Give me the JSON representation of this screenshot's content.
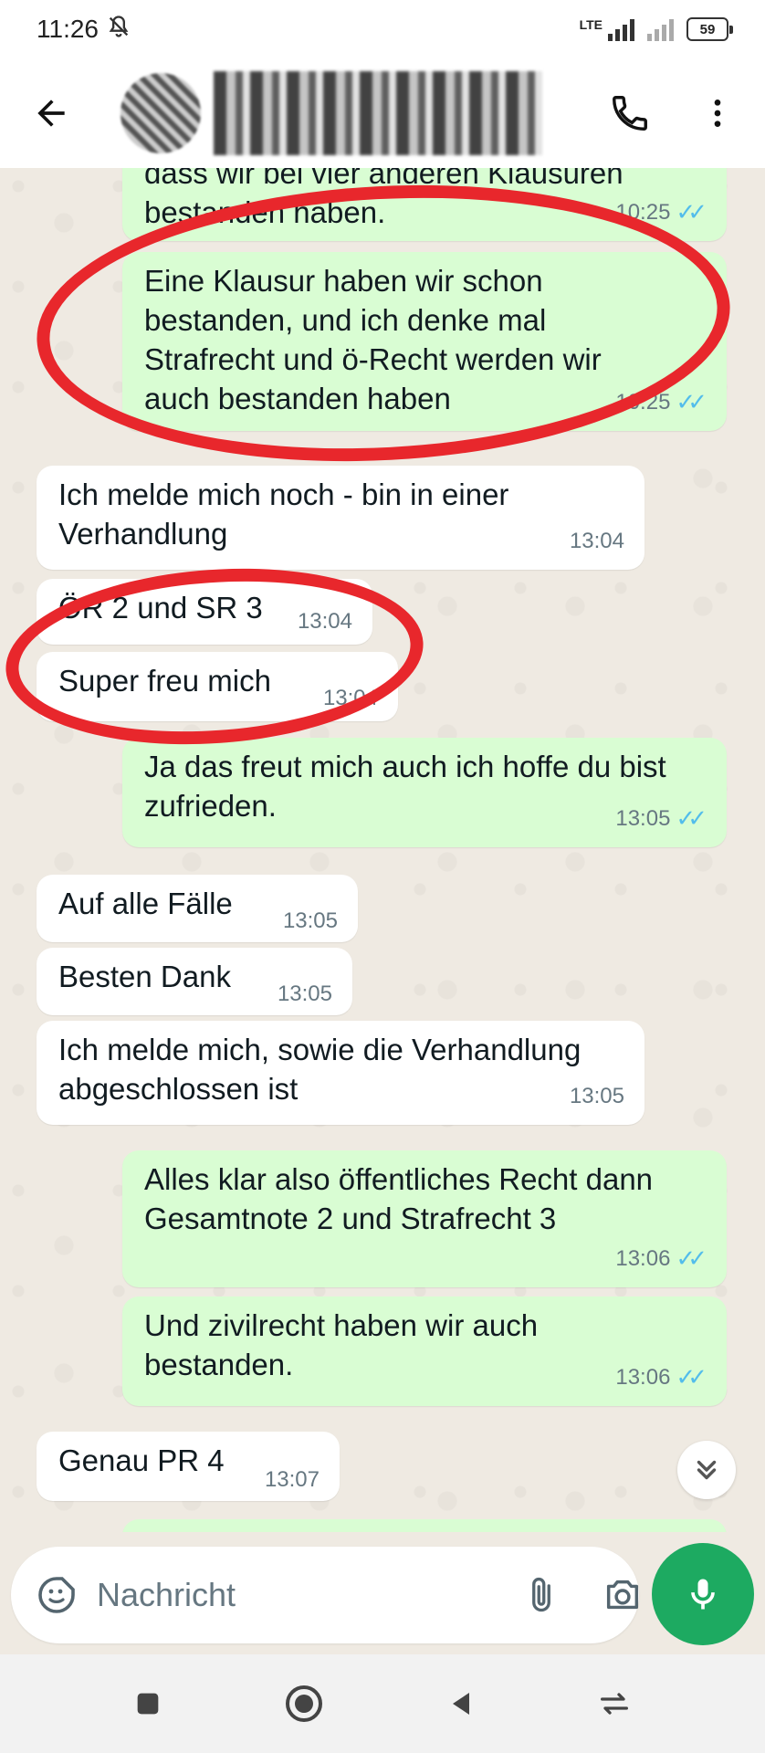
{
  "status_bar": {
    "time": "11:26",
    "network": "LTE",
    "battery": "59"
  },
  "header": {
    "contact_name": "",
    "icons": [
      "back-arrow-icon",
      "avatar",
      "video-call-icon",
      "phone-icon",
      "more-vert-icon"
    ]
  },
  "messages": [
    {
      "dir": "out",
      "text": "dass wir bei vier anderen Klausuren bestanden haben.",
      "time": "10:25",
      "ticks": "✓✓"
    },
    {
      "dir": "out",
      "text": "Eine Klausur haben wir schon bestanden, und ich denke mal Strafrecht und ö-Recht werden wir auch bestanden haben",
      "time": "10:25",
      "ticks": "✓✓"
    },
    {
      "dir": "in",
      "text": "Ich melde mich noch - bin in einer Verhandlung",
      "time": "13:04"
    },
    {
      "dir": "in",
      "text": "ÖR 2 und SR 3",
      "time": "13:04"
    },
    {
      "dir": "in",
      "text": "Super freu mich",
      "time": "13:04"
    },
    {
      "dir": "out",
      "text": "Ja das freut mich auch ich hoffe du bist zufrieden.",
      "time": "13:05",
      "ticks": "✓✓"
    },
    {
      "dir": "in",
      "text": "Auf alle Fälle",
      "time": "13:05"
    },
    {
      "dir": "in",
      "text": "Besten Dank",
      "time": "13:05"
    },
    {
      "dir": "in",
      "text": "Ich melde mich, sowie die Verhandlung abgeschlossen ist",
      "time": "13:05"
    },
    {
      "dir": "out",
      "text": "Alles klar also öffentliches Recht dann Gesamtnote 2 und Strafrecht 3",
      "time": "13:06",
      "ticks": "✓✓"
    },
    {
      "dir": "out",
      "text": "Und zivilrecht haben wir auch bestanden.",
      "time": "13:06",
      "ticks": "✓✓"
    },
    {
      "dir": "in",
      "text": "Genau PR 4",
      "time": "13:07"
    }
  ],
  "composer": {
    "placeholder": "Nachricht"
  },
  "colors": {
    "outgoing_bubble": "#d9fdd3",
    "incoming_bubble": "#ffffff",
    "chat_background": "#efeae2",
    "read_ticks": "#53bdeb",
    "mic_button": "#1daa61",
    "annotation": "#e8272c"
  }
}
